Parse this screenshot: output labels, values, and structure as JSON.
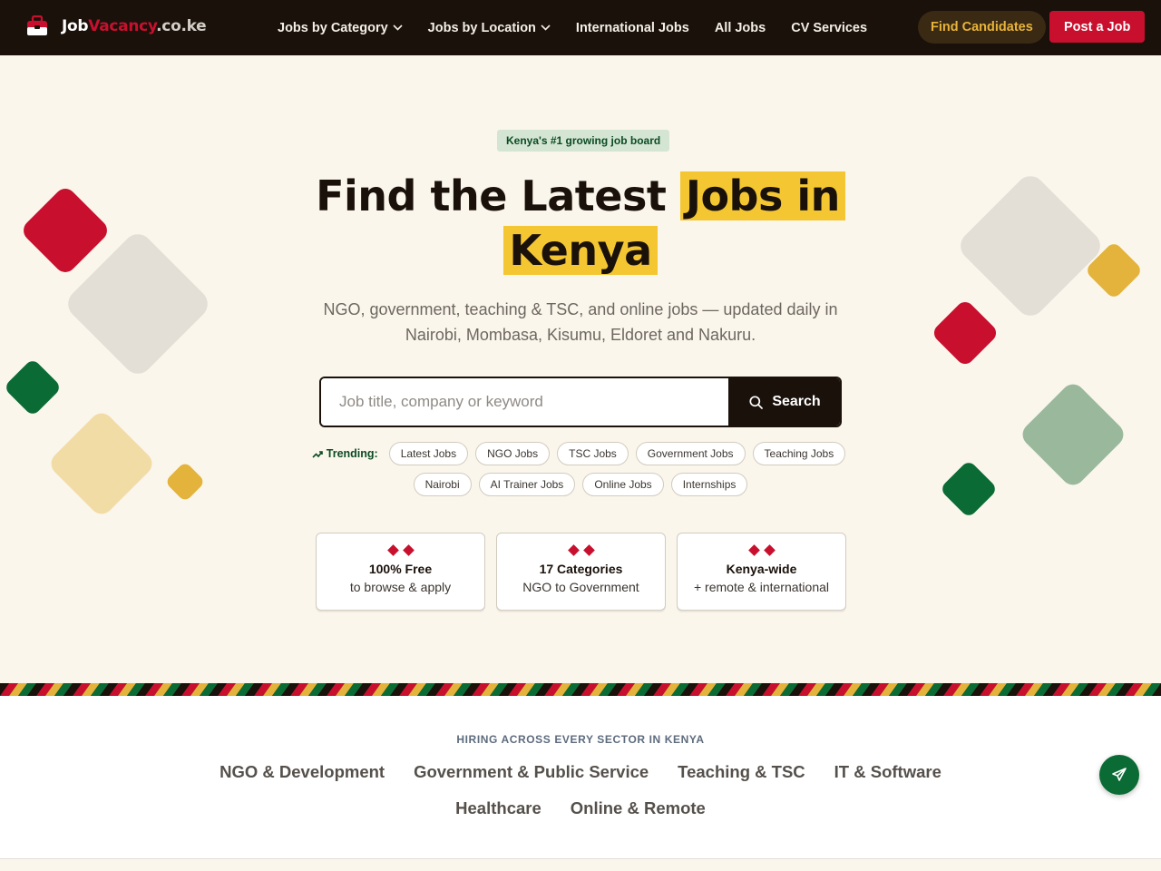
{
  "brand": {
    "name_part1": "Job",
    "name_part2": "Vacancy",
    "name_part3": ".co.ke",
    "icon": "briefcase-icon",
    "colors": {
      "red": "#c8102e",
      "green": "#0b6b34",
      "dark": "#1a110b",
      "yellow": "#f4c732",
      "gold": "#e8b33a"
    }
  },
  "nav": {
    "items": [
      {
        "label": "Jobs by Category",
        "dropdown": true
      },
      {
        "label": "Jobs by Location",
        "dropdown": true
      },
      {
        "label": "International Jobs",
        "dropdown": false
      },
      {
        "label": "All Jobs",
        "dropdown": false
      },
      {
        "label": "CV Services",
        "dropdown": false
      }
    ],
    "find_candidates": "Find Candidates",
    "post_job": "Post a Job"
  },
  "hero": {
    "badge": "Kenya's #1 growing job board",
    "headline_plain": "Find the Latest",
    "headline_highlight_1": "Jobs in",
    "headline_highlight_2": "Kenya",
    "subtext": "NGO, government, teaching & TSC, and online jobs — updated daily in Nairobi, Mombasa, Kisumu, Eldoret and Nakuru."
  },
  "search": {
    "placeholder": "Job title, company or keyword",
    "value": "",
    "button_label": "Search",
    "icon": "search-icon"
  },
  "trending": {
    "label": "Trending:",
    "icon": "trending-up-icon",
    "chips": [
      "Latest Jobs",
      "NGO Jobs",
      "TSC Jobs",
      "Government Jobs",
      "Teaching Jobs",
      "Nairobi",
      "AI Trainer Jobs",
      "Online Jobs",
      "Internships"
    ]
  },
  "cards": [
    {
      "title": "100% Free",
      "subtitle": "to browse & apply"
    },
    {
      "title": "17 Categories",
      "subtitle": "NGO to Government"
    },
    {
      "title": "Kenya-wide",
      "subtitle": "+ remote & international"
    }
  ],
  "sectors": {
    "title": "HIRING ACROSS EVERY SECTOR IN KENYA",
    "items": [
      "NGO & Development",
      "Government & Public Service",
      "Teaching & TSC",
      "IT & Software",
      "Healthcare",
      "Online & Remote"
    ]
  },
  "fab": {
    "icon": "send-icon"
  }
}
